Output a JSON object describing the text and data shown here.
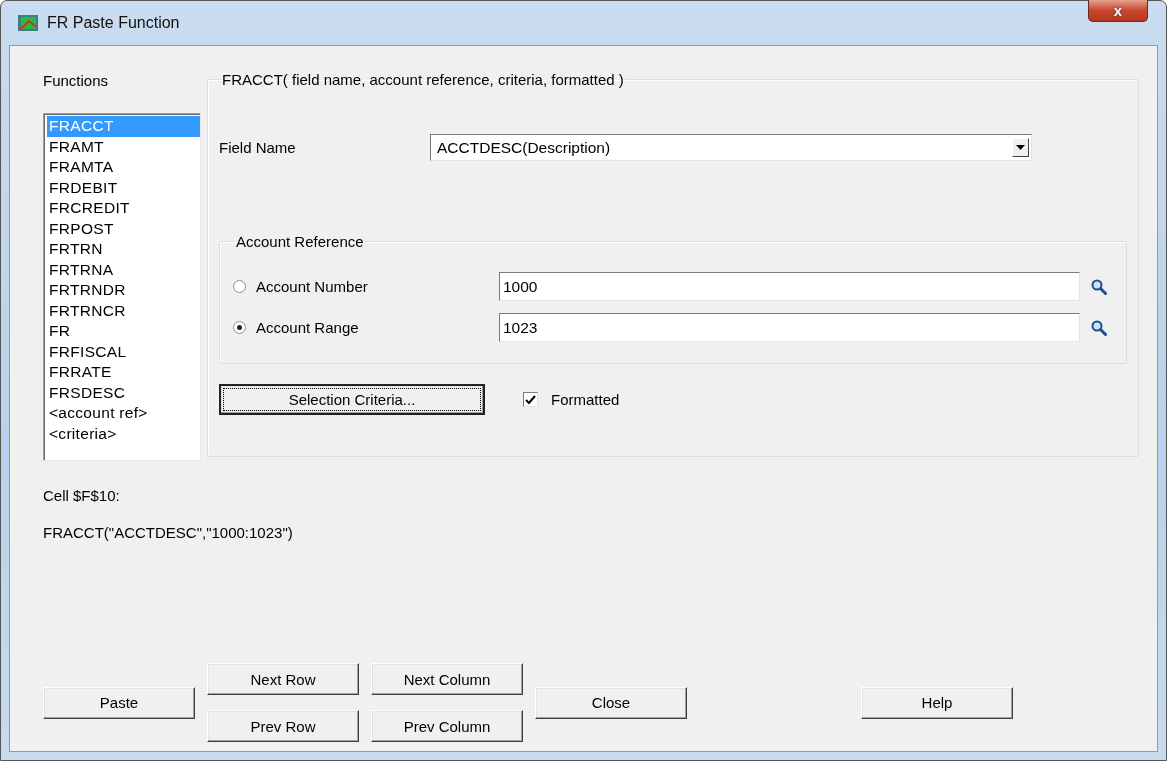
{
  "window": {
    "title": "FR Paste Function",
    "close": "x"
  },
  "functions": {
    "label": "Functions",
    "items": [
      {
        "label": "FRACCT",
        "selected": true
      },
      {
        "label": "FRAMT",
        "selected": false
      },
      {
        "label": "FRAMTA",
        "selected": false
      },
      {
        "label": "FRDEBIT",
        "selected": false
      },
      {
        "label": "FRCREDIT",
        "selected": false
      },
      {
        "label": "FRPOST",
        "selected": false
      },
      {
        "label": "FRTRN",
        "selected": false
      },
      {
        "label": "FRTRNA",
        "selected": false
      },
      {
        "label": "FRTRNDR",
        "selected": false
      },
      {
        "label": "FRTRNCR",
        "selected": false
      },
      {
        "label": "FR",
        "selected": false
      },
      {
        "label": "FRFISCAL",
        "selected": false
      },
      {
        "label": "FRRATE",
        "selected": false
      },
      {
        "label": "FRSDESC",
        "selected": false
      },
      {
        "label": "<account ref>",
        "selected": false
      },
      {
        "label": "<criteria>",
        "selected": false
      }
    ]
  },
  "signature": {
    "legend": "FRACCT( field name, account reference, criteria, formatted )",
    "field_name": {
      "label": "Field Name",
      "value": "ACCTDESC(Description)"
    },
    "account_reference": {
      "legend": "Account Reference",
      "options": [
        {
          "label": "Account Number",
          "value": "1000",
          "selected": false
        },
        {
          "label": "Account Range",
          "value": "1023",
          "selected": true
        }
      ]
    },
    "selection_criteria": {
      "label": "Selection Criteria...",
      "focused": true
    },
    "formatted": {
      "label": "Formatted",
      "checked": true
    }
  },
  "cell": {
    "label": "Cell $F$10:",
    "formula": "FRACCT(\"ACCTDESC\",\"1000:1023\")"
  },
  "buttons": {
    "paste": {
      "label": "Paste"
    },
    "next_row": {
      "label": "Next Row"
    },
    "prev_row": {
      "label": "Prev Row"
    },
    "next_column": {
      "label": "Next Column"
    },
    "prev_column": {
      "label": "Prev Column"
    },
    "close": {
      "label": "Close"
    },
    "help": {
      "label": "Help"
    }
  }
}
